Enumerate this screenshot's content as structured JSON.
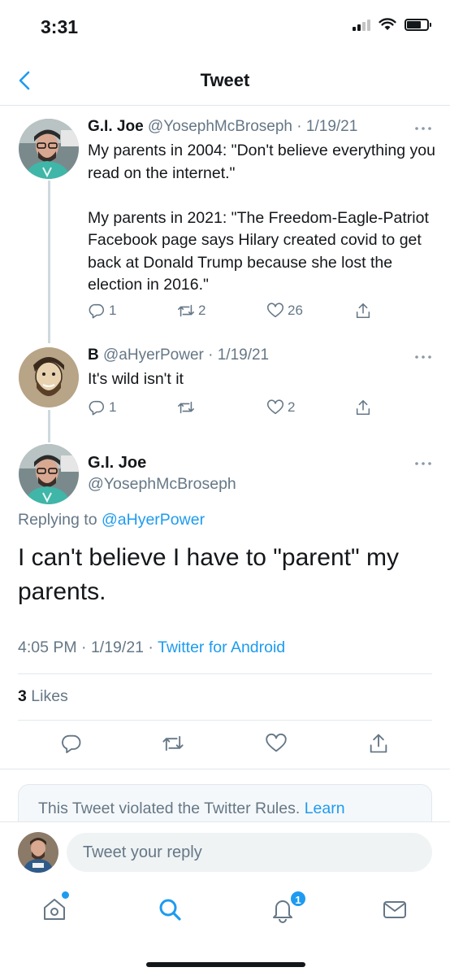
{
  "status_bar": {
    "time": "3:31"
  },
  "nav": {
    "title": "Tweet"
  },
  "tweets": [
    {
      "name": "G.I. Joe",
      "handle": "@YosephMcBroseph",
      "date": "· 1/19/21",
      "text": "My parents in 2004: \"Don't believe everything you read on the internet.\"\n\nMy parents in 2021: \"The Freedom-Eagle-Patriot Facebook page says Hilary created covid to get back at Donald Trump because she lost the election in 2016.\"",
      "replies": "1",
      "retweets": "2",
      "likes": "26"
    },
    {
      "name": "B",
      "handle": "@aHyerPower",
      "date": "· 1/19/21",
      "text": "It's wild isn't it",
      "replies": "1",
      "retweets": "",
      "likes": "2"
    }
  ],
  "focused": {
    "name": "G.I. Joe",
    "handle": "@YosephMcBroseph",
    "replying_prefix": "Replying to ",
    "replying_to": "@aHyerPower",
    "text": "I can't believe I have to \"parent\" my parents.",
    "time": "4:05 PM · 1/19/21 · ",
    "source": "Twitter for Android",
    "likes_count": "3",
    "likes_label": " Likes"
  },
  "violation": {
    "text": "This Tweet violated the Twitter Rules. ",
    "link": "Learn"
  },
  "reply": {
    "placeholder": "Tweet your reply"
  },
  "tabs": {
    "notifications_badge": "1",
    "items": [
      "home-icon",
      "search-icon",
      "notifications-icon",
      "messages-icon"
    ]
  },
  "colors": {
    "accent": "#1d9bf0",
    "secondary_text": "#657786",
    "border": "#e1e8ed"
  }
}
